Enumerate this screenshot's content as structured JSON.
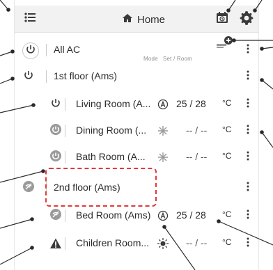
{
  "header": {
    "title": "Home",
    "icons": {
      "menu": "menu-icon",
      "home": "home-icon",
      "schedule": "schedule-icon",
      "settings": "gear-icon"
    }
  },
  "mini_labels": {
    "mode": "Mode",
    "set_room": "Set / Room"
  },
  "rows": [
    {
      "name": "All AC",
      "value": "",
      "unit": "",
      "mode_icon": "add-icon"
    },
    {
      "name": "1st floor (Ams)",
      "value": "",
      "unit": ""
    },
    {
      "name": "Living Room (A...",
      "value": "25 / 28",
      "unit": "°C",
      "mode_icon": "auto-mode-icon"
    },
    {
      "name": "Dining Room (...",
      "value": "-- / --",
      "unit": "°C",
      "mode_icon": "snowflake-icon"
    },
    {
      "name": "Bath Room (A...",
      "value": "-- / --",
      "unit": "°C",
      "mode_icon": "snowflake-icon"
    },
    {
      "name": "2nd floor (Ams)",
      "value": "",
      "unit": ""
    },
    {
      "name": "Bed Room (Ams)",
      "value": "25 / 28",
      "unit": "°C",
      "mode_icon": "auto-mode-icon"
    },
    {
      "name": "Children Room...",
      "value": "-- / --",
      "unit": "°C",
      "mode_icon": "sun-icon"
    }
  ],
  "colors": {
    "text": "#2a2a2a",
    "muted": "#8f8f8f",
    "divider": "#c9c9c9",
    "dash": "#e03a3a",
    "icon_dark": "#3a3a3a",
    "icon_gray": "#9a9a9a"
  }
}
